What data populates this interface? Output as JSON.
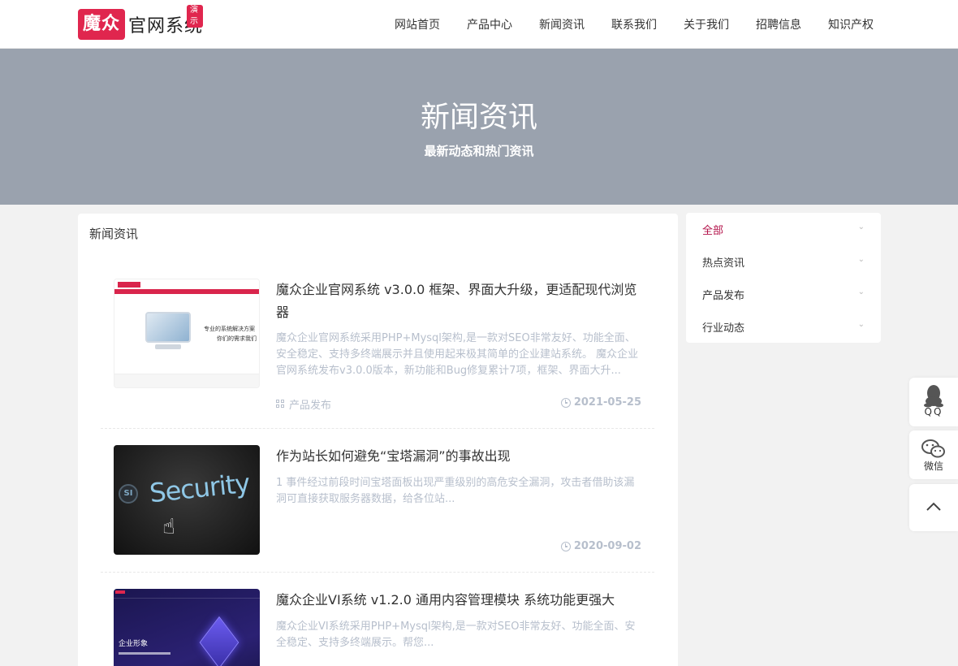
{
  "logo": {
    "mark": "魔众",
    "text": "官网系统",
    "badge": "演示"
  },
  "nav": {
    "items": [
      "网站首页",
      "产品中心",
      "新闻资讯",
      "联系我们",
      "关于我们",
      "招聘信息",
      "知识产权"
    ]
  },
  "banner": {
    "title": "新闻资讯",
    "subtitle": "最新动态和热门资讯"
  },
  "main": {
    "title": "新闻资讯",
    "items": [
      {
        "title": "魔众企业官网系统 v3.0.0 框架、界面大升级，更适配现代浏览器",
        "desc": "魔众企业官网系统采用PHP+Mysql架构,是一款对SEO非常友好、功能全面、安全稳定、支持多终端展示并且使用起来极其简单的企业建站系统。 魔众企业官网系统发布v3.0.0版本，新功能和Bug修复累计7项，框架、界面大升...",
        "category": "产品发布",
        "date": "2021-05-25",
        "thumb_text": [
          "专业的系统解决方案",
          "你们的需求我们"
        ]
      },
      {
        "title": "作为站长如何避免“宝塔漏洞”的事故出现",
        "desc": "1 事件经过前段时间宝塔面板出现严重级别的高危安全漏洞，攻击者借助该漏洞可直接获取服务器数据，给各位站...",
        "category": "",
        "date": "2020-09-02",
        "thumb_text": [
          "Security"
        ]
      },
      {
        "title": "魔众企业VI系统 v1.2.0 通用内容管理模块 系统功能更强大",
        "desc": "魔众企业VI系统采用PHP+Mysql架构,是一款对SEO非常友好、功能全面、安全稳定、支持多终端展示。帮您...",
        "category": "",
        "date": "",
        "thumb_text": [
          "企业形象"
        ]
      }
    ]
  },
  "sidebar": {
    "items": [
      {
        "label": "全部",
        "active": true
      },
      {
        "label": "热点资讯",
        "active": false
      },
      {
        "label": "产品发布",
        "active": false
      },
      {
        "label": "行业动态",
        "active": false
      }
    ],
    "active_color": "#b3124a"
  },
  "float": {
    "qq": "QQ",
    "wechat": "微信"
  },
  "colors": {
    "brand": "#e0264e",
    "banner": "#9aa2ae",
    "muted": "#b7bfcc"
  }
}
